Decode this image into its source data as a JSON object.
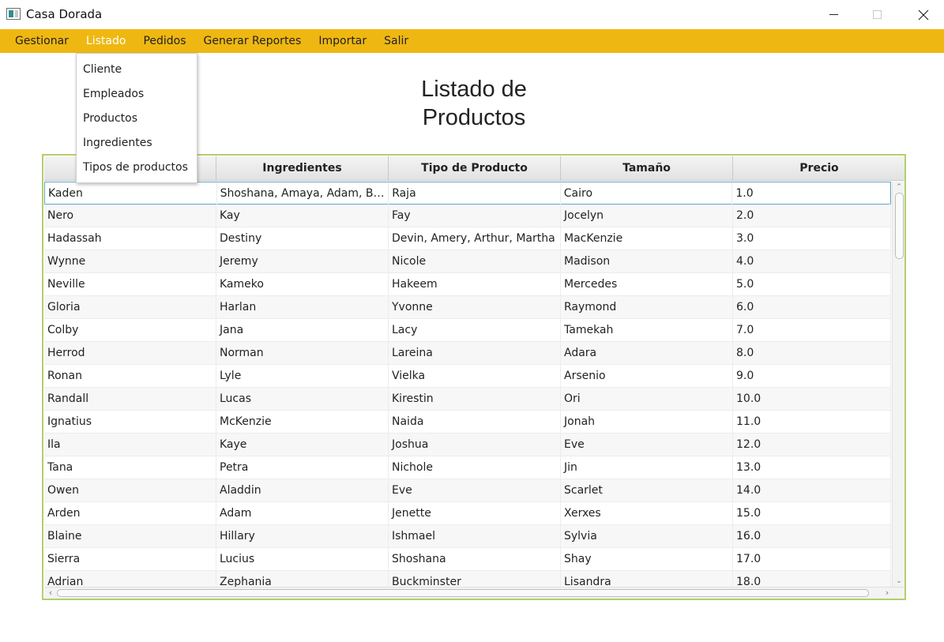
{
  "window": {
    "title": "Casa Dorada",
    "icon": "app-window-icon"
  },
  "menubar": {
    "items": [
      {
        "label": "Gestionar"
      },
      {
        "label": "Listado",
        "active": true
      },
      {
        "label": "Pedidos"
      },
      {
        "label": "Generar Reportes"
      },
      {
        "label": "Importar"
      },
      {
        "label": "Salir"
      }
    ],
    "color": "#efb711"
  },
  "dropdown": {
    "items": [
      "Cliente",
      "Empleados",
      "Productos",
      "Ingredientes",
      "Tipos de productos"
    ]
  },
  "page": {
    "heading_line1": "Listado de",
    "heading_line2": "Productos"
  },
  "table": {
    "columns": [
      "",
      "Ingredientes",
      "Tipo de Producto",
      "Tamaño",
      "Precio"
    ],
    "rows": [
      [
        "Kaden",
        "Shoshana, Amaya, Adam, Barrett",
        "Raja",
        "Cairo",
        "1.0"
      ],
      [
        "Nero",
        "Kay",
        "Fay",
        "Jocelyn",
        "2.0"
      ],
      [
        "Hadassah",
        "Destiny",
        "Devin, Amery, Arthur, Martha",
        "MacKenzie",
        "3.0"
      ],
      [
        "Wynne",
        "Jeremy",
        "Nicole",
        "Madison",
        "4.0"
      ],
      [
        "Neville",
        "Kameko",
        "Hakeem",
        "Mercedes",
        "5.0"
      ],
      [
        "Gloria",
        "Harlan",
        "Yvonne",
        "Raymond",
        "6.0"
      ],
      [
        "Colby",
        "Jana",
        "Lacy",
        "Tamekah",
        "7.0"
      ],
      [
        "Herrod",
        "Norman",
        "Lareina",
        "Adara",
        "8.0"
      ],
      [
        "Ronan",
        "Lyle",
        "Vielka",
        "Arsenio",
        "9.0"
      ],
      [
        "Randall",
        "Lucas",
        "Kirestin",
        "Ori",
        "10.0"
      ],
      [
        "Ignatius",
        "McKenzie",
        "Naida",
        "Jonah",
        "11.0"
      ],
      [
        "Ila",
        "Kaye",
        "Joshua",
        "Eve",
        "12.0"
      ],
      [
        "Tana",
        "Petra",
        "Nichole",
        "Jin",
        "13.0"
      ],
      [
        "Owen",
        "Aladdin",
        "Eve",
        "Scarlet",
        "14.0"
      ],
      [
        "Arden",
        "Adam",
        "Jenette",
        "Xerxes",
        "15.0"
      ],
      [
        "Blaine",
        "Hillary",
        "Ishmael",
        "Sylvia",
        "16.0"
      ],
      [
        "Sierra",
        "Lucius",
        "Shoshana",
        "Shay",
        "17.0"
      ],
      [
        "Adrian",
        "Zephania",
        "Buckminster",
        "Lisandra",
        "18.0"
      ]
    ],
    "selected_row": 0,
    "border_color": "#b3cf6a"
  }
}
